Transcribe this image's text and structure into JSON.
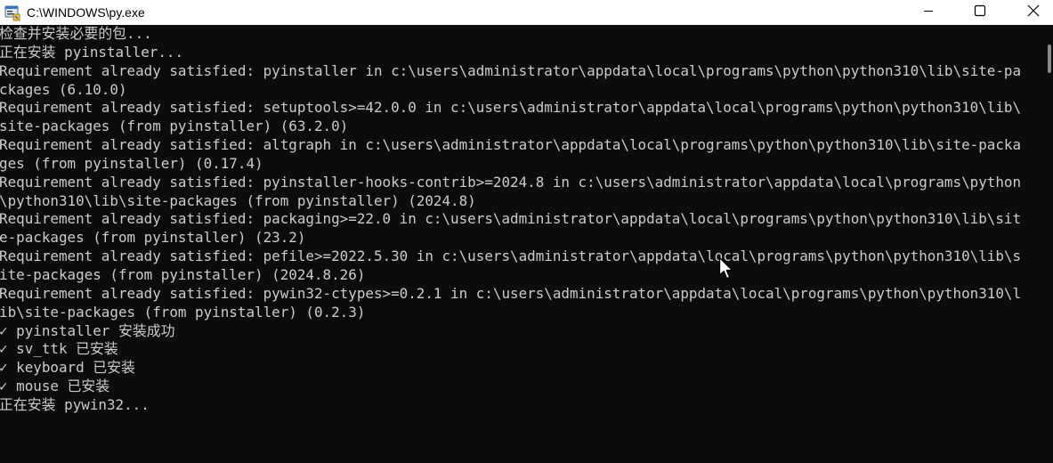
{
  "window": {
    "title": "C:\\WINDOWS\\py.exe",
    "icons": {
      "app": "console-app-icon",
      "minimize": "minimize-icon",
      "maximize": "maximize-icon",
      "close": "close-icon",
      "pointer": "mouse-pointer-icon"
    }
  },
  "console": {
    "lines": [
      "检查并安装必要的包...",
      "正在安装 pyinstaller...",
      "Requirement already satisfied: pyinstaller in c:\\users\\administrator\\appdata\\local\\programs\\python\\python310\\lib\\site-pa",
      "ckages (6.10.0)",
      "Requirement already satisfied: setuptools>=42.0.0 in c:\\users\\administrator\\appdata\\local\\programs\\python\\python310\\lib\\",
      "site-packages (from pyinstaller) (63.2.0)",
      "Requirement already satisfied: altgraph in c:\\users\\administrator\\appdata\\local\\programs\\python\\python310\\lib\\site-packa",
      "ges (from pyinstaller) (0.17.4)",
      "Requirement already satisfied: pyinstaller-hooks-contrib>=2024.8 in c:\\users\\administrator\\appdata\\local\\programs\\python",
      "\\python310\\lib\\site-packages (from pyinstaller) (2024.8)",
      "Requirement already satisfied: packaging>=22.0 in c:\\users\\administrator\\appdata\\local\\programs\\python\\python310\\lib\\sit",
      "e-packages (from pyinstaller) (23.2)",
      "Requirement already satisfied: pefile>=2022.5.30 in c:\\users\\administrator\\appdata\\local\\programs\\python\\python310\\lib\\s",
      "ite-packages (from pyinstaller) (2024.8.26)",
      "Requirement already satisfied: pywin32-ctypes>=0.2.1 in c:\\users\\administrator\\appdata\\local\\programs\\python\\python310\\l",
      "ib\\site-packages (from pyinstaller) (0.2.3)",
      "✓ pyinstaller 安装成功",
      "✓ sv_ttk 已安装",
      "✓ keyboard 已安装",
      "✓ mouse 已安装",
      "正在安装 pywin32..."
    ]
  }
}
